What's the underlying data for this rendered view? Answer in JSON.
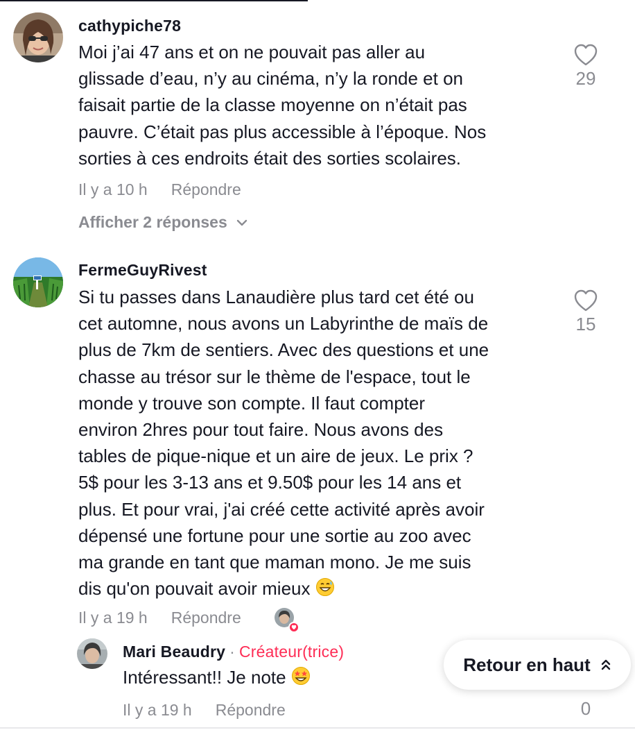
{
  "comments": [
    {
      "username": "cathypiche78",
      "text": "Moi j’ai 47 ans et on ne pouvait pas aller au glissade d’eau, n’y au cinéma, n’y la ronde et on faisait partie de la classe moyenne on n’était pas pauvre. C’était pas plus accessible à l’époque. Nos sorties à ces endroits était des sorties scolaires.",
      "lines": [
        "Moi j’ai 47 ans et on ne pouvait pas aller au",
        "glissade d’eau, n’y au cinéma, n’y la ronde et on",
        "faisait partie de la classe moyenne on n’était pas",
        "pauvre. C’était pas plus accessible à l’époque. Nos",
        "sorties à ces endroits était des sorties scolaires."
      ],
      "time": "Il y a 10 h",
      "reply_label": "Répondre",
      "likes": "29",
      "show_replies": "Afficher 2 réponses",
      "avatar_icon": "user-avatar-photo"
    },
    {
      "username": "FermeGuyRivest",
      "lines": [
        "Si tu passes dans Lanaudière plus tard cet été ou",
        "cet automne, nous avons un Labyrinthe de maïs de",
        "plus de 7km de sentiers. Avec des questions et une",
        "chasse au trésor sur le thème de l'espace, tout le",
        "monde y trouve son compte. Il faut compter",
        "environ 2hres pour tout faire. Nous avons des",
        "tables de pique-nique et un aire de jeux. Le prix ?",
        "5$ pour les 3-13 ans et 9.50$ pour les 14 ans et",
        "plus. Et pour vrai, j'ai créé cette activité après avoir",
        "dépensé une fortune pour une sortie au zoo avec",
        "ma grande en tant que maman mono. Je me suis",
        "dis qu'on pouvait avoir mieux"
      ],
      "time": "Il y a 19 h",
      "reply_label": "Répondre",
      "likes": "15",
      "avatar_icon": "cornfield-avatar"
    }
  ],
  "reply": {
    "username": "Mari Beaudry",
    "separator": "·",
    "creator_label": "Créateur(trice)",
    "text": "Intéressant!! Je note",
    "time": "Il y a 19 h",
    "reply_label": "Répondre",
    "likes": "0"
  },
  "back_to_top": {
    "label": "Retour en haut",
    "icon": "double-chevron-up-icon"
  },
  "colors": {
    "accent": "#fe2c55",
    "text": "#161823",
    "muted": "#8a8b91"
  }
}
